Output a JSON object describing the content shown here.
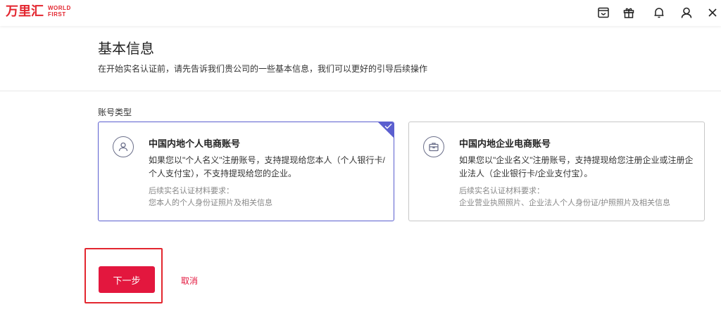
{
  "brand": {
    "name_cn": "万里汇",
    "name_en_line1": "WORLD",
    "name_en_line2": "FIRST",
    "color": "#e3262f"
  },
  "topbar": {
    "icons": [
      "inbox-icon",
      "gift-icon",
      "bell-icon",
      "user-icon",
      "close-icon"
    ]
  },
  "header": {
    "title": "基本信息",
    "subtitle": "在开始实名认证前，请先告诉我们贵公司的一些基本信息，我们可以更好的引导后续操作"
  },
  "account_type": {
    "label": "账号类型",
    "options": [
      {
        "title": "中国内地个人电商账号",
        "desc": "如果您以\"个人名义\"注册账号，支持提现给您本人（个人银行卡/个人支付宝），不支持提现给您的企业。",
        "req_label": "后续实名认证材料要求：",
        "req": "您本人的个人身份证照片及相关信息",
        "icon": "person-icon",
        "selected": true
      },
      {
        "title": "中国内地企业电商账号",
        "desc": "如果您以\"企业名义\"注册账号，支持提现给您注册企业或注册企业法人（企业银行卡/企业支付宝）。",
        "req_label": "后续实名认证材料要求：",
        "req": "企业营业执照照片、企业法人个人身份证/护照照片及相关信息",
        "icon": "briefcase-icon",
        "selected": false
      }
    ]
  },
  "actions": {
    "next": "下一步",
    "cancel": "取消"
  },
  "colors": {
    "accent": "#e3173e",
    "selected_border": "#5b5fcf"
  }
}
